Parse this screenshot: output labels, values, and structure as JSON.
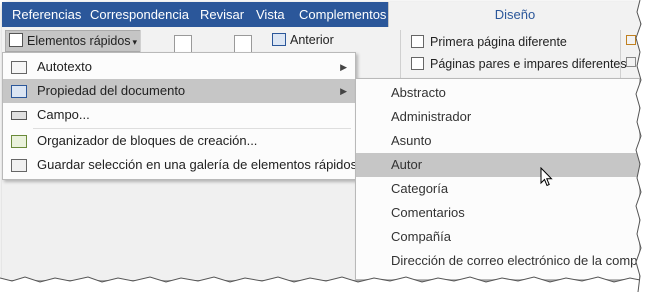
{
  "ribbon_tabs": [
    "Referencias",
    "Correspondencia",
    "Revisar",
    "Vista",
    "Complementos"
  ],
  "context_tab": "Diseño",
  "ribbon": {
    "quick_parts_label": "Elementos rápidos",
    "previous_label": "Anterior",
    "checkbox_first_page": "Primera página diferente",
    "checkbox_odd_even": "Páginas pares e impares diferentes"
  },
  "menu": {
    "items": [
      {
        "label": "Autotexto",
        "icon": "autotext-icon",
        "submenu": true
      },
      {
        "label": "Propiedad del documento",
        "icon": "document-property-icon",
        "submenu": true,
        "highlighted": true
      },
      {
        "label": "Campo...",
        "icon": "field-icon",
        "submenu": false
      },
      {
        "label": "Organizador de bloques de creación...",
        "icon": "building-blocks-icon",
        "submenu": false
      },
      {
        "label": "Guardar selección en una galería de elementos rápidos...",
        "icon": "save-selection-icon",
        "submenu": false
      }
    ]
  },
  "submenu": {
    "items": [
      "Abstracto",
      "Administrador",
      "Asunto",
      "Autor",
      "Categoría",
      "Comentarios",
      "Compañía",
      "Dirección de correo electrónico de la compañía"
    ],
    "highlighted": "Autor"
  },
  "colors": {
    "ribbon_tab_bar": "#2b579a",
    "highlight": "#c6c6c6",
    "menu_bg": "#fcfcfc"
  }
}
